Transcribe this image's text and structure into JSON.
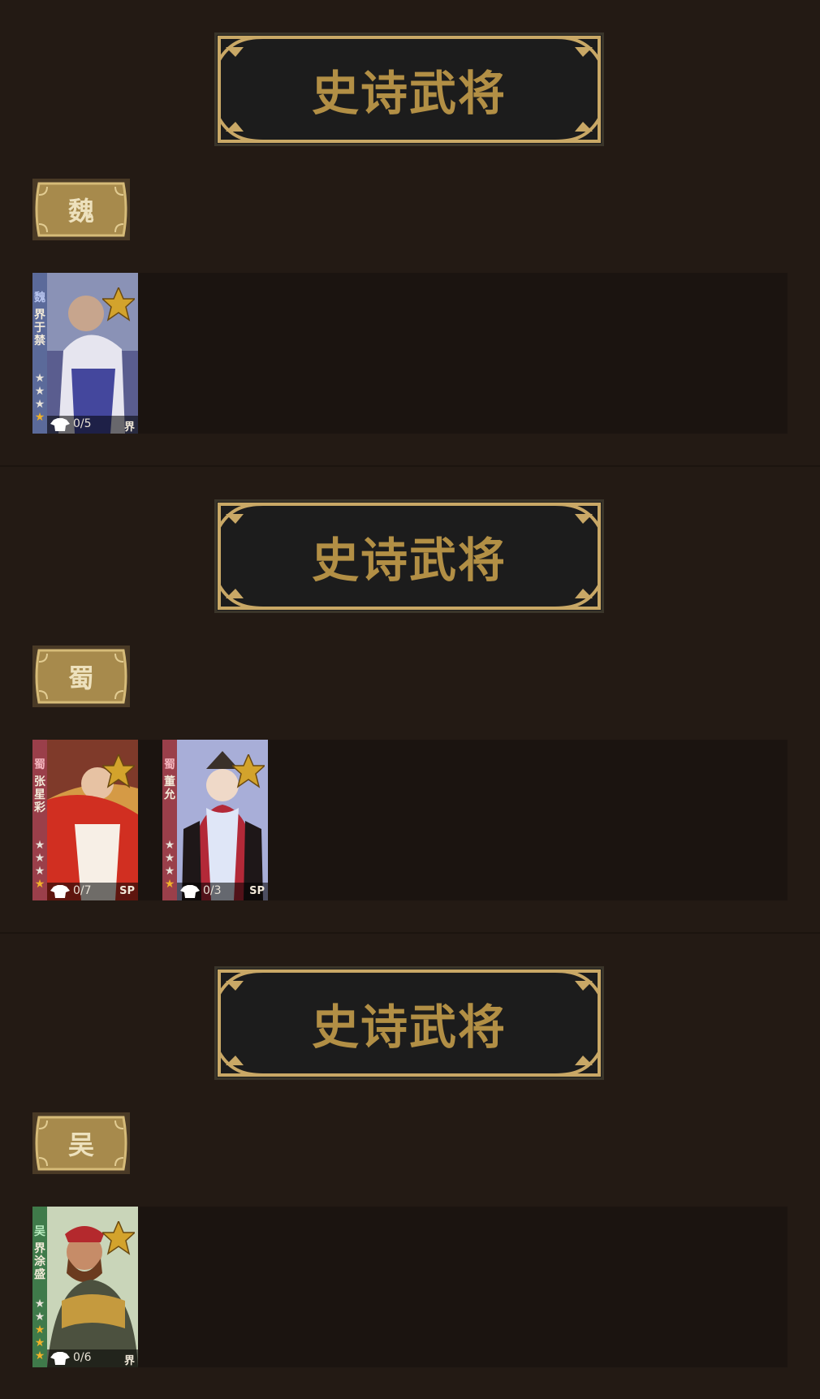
{
  "colors": {
    "page_bg": "#231a14",
    "row_bg": "#1b1410",
    "gold": "#b28f45",
    "wei_side": "#5b6a9a",
    "shu_side": "#9a3f4a",
    "wu_side": "#3f7a4a"
  },
  "sections": [
    {
      "banner_title": "史诗武将",
      "faction": "魏",
      "cards": [
        {
          "faction_char": "魏",
          "name": "界于禁",
          "skins": "0/5",
          "type": "界",
          "badge_text": "史诗",
          "stars_filled": 1,
          "stars_total": 4
        }
      ]
    },
    {
      "banner_title": "史诗武将",
      "faction": "蜀",
      "cards": [
        {
          "faction_char": "蜀",
          "name": "张星彩",
          "skins": "0/7",
          "type": "SP",
          "badge_text": "史诗",
          "stars_filled": 1,
          "stars_total": 4
        },
        {
          "faction_char": "蜀",
          "name": "董允",
          "skins": "0/3",
          "type": "SP",
          "badge_text": "史诗",
          "stars_filled": 1,
          "stars_total": 4
        }
      ]
    },
    {
      "banner_title": "史诗武将",
      "faction": "吴",
      "cards": [
        {
          "faction_char": "吴",
          "name": "界涂盛",
          "skins": "0/6",
          "type": "界",
          "badge_text": "史诗",
          "stars_filled": 3,
          "stars_total": 5
        }
      ]
    }
  ]
}
